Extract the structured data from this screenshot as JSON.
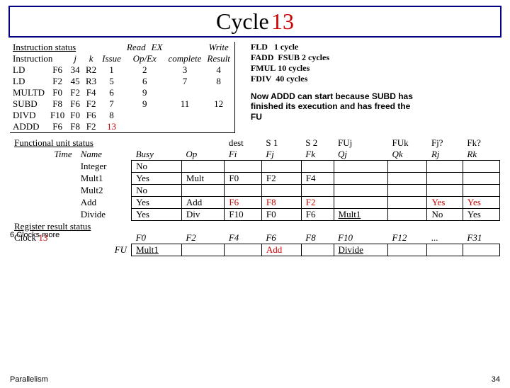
{
  "title": {
    "word1": "Cycle",
    "word2": "13"
  },
  "instr": {
    "heading": "Instruction status",
    "cols": {
      "instr": "Instruction",
      "j": "j",
      "k": "k",
      "issue": "Issue",
      "opex": "Op/Ex",
      "read": "Read",
      "ex": "EX",
      "complete": "complete",
      "write": "Write",
      "result": "Result"
    },
    "rows": [
      {
        "op": "LD",
        "d": "F6",
        "j": "34",
        "k": "R2",
        "issue": "1",
        "opex": "2",
        "comp": "3",
        "wr": "4"
      },
      {
        "op": "LD",
        "d": "F2",
        "j": "45",
        "k": "R3",
        "issue": "5",
        "opex": "6",
        "comp": "7",
        "wr": "8"
      },
      {
        "op": "MULTD",
        "d": "F0",
        "j": "F2",
        "k": "F4",
        "issue": "6",
        "opex": "9",
        "comp": "",
        "wr": ""
      },
      {
        "op": "SUBD",
        "d": "F8",
        "j": "F6",
        "k": "F2",
        "issue": "7",
        "opex": "9",
        "comp": "11",
        "wr": "12"
      },
      {
        "op": "DIVD",
        "d": "F10",
        "j": "F0",
        "k": "F6",
        "issue": "8",
        "opex": "",
        "comp": "",
        "wr": ""
      },
      {
        "op": "ADDD",
        "d": "F6",
        "j": "F8",
        "k": "F2",
        "issue": "13",
        "opex": "",
        "comp": "",
        "wr": ""
      }
    ]
  },
  "notes": {
    "l1a": "FLD",
    "l1b": "1 cycle",
    "l2a": "FADD",
    "l2b": "FSUB 2 cycles",
    "l3a": "FMUL",
    "l3b": "10 cycles",
    "l4a": "FDIV",
    "l4b": "40 cycles",
    "comment": "Now ADDD can start because SUBD has finished its execution and has freed the FU"
  },
  "fu": {
    "heading": "Functional unit status",
    "cols": {
      "time": "Time",
      "name": "Name",
      "busy": "Busy",
      "op": "Op",
      "dest": "dest",
      "fi": "Fi",
      "s1": "S 1",
      "fj": "Fj",
      "s2": "S 2",
      "fk": "Fk",
      "fuj": "FUj",
      "qj": "Qj",
      "fuk": "FUk",
      "qk": "Qk",
      "fjq": "Fj?",
      "rj": "Rj",
      "fkq": "Fk?",
      "rk": "Rk"
    },
    "rows": [
      {
        "name": "Integer",
        "busy": "No",
        "op": "",
        "fi": "",
        "fj": "",
        "fk": "",
        "qj": "",
        "qk": "",
        "rj": "",
        "rk": ""
      },
      {
        "name": "Mult1",
        "busy": "Yes",
        "op": "Mult",
        "fi": "F0",
        "fj": "F2",
        "fk": "F4",
        "qj": "",
        "qk": "",
        "rj": "",
        "rk": ""
      },
      {
        "name": "Mult2",
        "busy": "No",
        "op": "",
        "fi": "",
        "fj": "",
        "fk": "",
        "qj": "",
        "qk": "",
        "rj": "",
        "rk": ""
      },
      {
        "name": "Add",
        "busy": "Yes",
        "op": "Add",
        "fi": "F6",
        "fj": "F8",
        "fk": "F2",
        "qj": "",
        "qk": "",
        "rj": "Yes",
        "rk": "Yes"
      },
      {
        "name": "Divide",
        "busy": "Yes",
        "op": "Div",
        "fi": "F10",
        "fj": "F0",
        "fk": "F6",
        "qj": "Mult1",
        "qk": "",
        "rj": "No",
        "rk": "Yes"
      }
    ]
  },
  "clocks_more": "6 Clocks more",
  "reg": {
    "heading": "Register result status",
    "clock_label": "Clock",
    "clock_val": "13",
    "fu_label": "FU",
    "cols": [
      "F0",
      "F2",
      "F4",
      "F6",
      "F8",
      "F10",
      "F12",
      "...",
      "F31"
    ],
    "vals": [
      "Mult1",
      "",
      "",
      "Add",
      "",
      "Divide",
      "",
      "",
      ""
    ]
  },
  "footer": {
    "left": "Parallelism",
    "right": "34"
  }
}
